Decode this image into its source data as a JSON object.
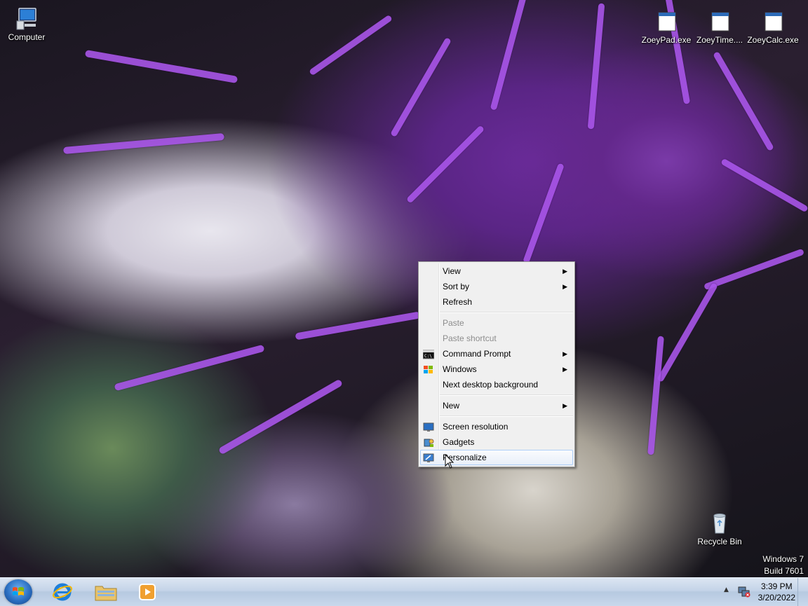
{
  "desktop": {
    "icons": [
      {
        "label": "Computer"
      },
      {
        "label": "ZoeyPad.exe"
      },
      {
        "label": "ZoeyTime...."
      },
      {
        "label": "ZoeyCalc.exe"
      },
      {
        "label": "Recycle Bin"
      }
    ],
    "watermark": {
      "line1": "Windows 7",
      "line2": "Build 7601"
    }
  },
  "context_menu": {
    "items": [
      {
        "label": "View",
        "submenu": true
      },
      {
        "label": "Sort by",
        "submenu": true
      },
      {
        "label": "Refresh"
      },
      {
        "label": "Paste",
        "disabled": true
      },
      {
        "label": "Paste shortcut",
        "disabled": true
      },
      {
        "label": "Command Prompt",
        "submenu": true,
        "icon": "cmd-icon"
      },
      {
        "label": "Windows",
        "submenu": true,
        "icon": "windows-flag-icon"
      },
      {
        "label": "Next desktop background"
      },
      {
        "label": "New",
        "submenu": true
      },
      {
        "label": "Screen resolution",
        "icon": "monitor-icon"
      },
      {
        "label": "Gadgets",
        "icon": "gadgets-icon"
      },
      {
        "label": "Personalize",
        "icon": "personalize-icon",
        "highlighted": true
      }
    ],
    "arrow_glyph": "▶"
  },
  "taskbar": {
    "pinned": [
      "internet-explorer-icon",
      "file-explorer-icon",
      "media-player-icon"
    ],
    "clock": {
      "time": "3:39 PM",
      "date": "3/20/2022"
    },
    "tray_arrow": "▲"
  }
}
